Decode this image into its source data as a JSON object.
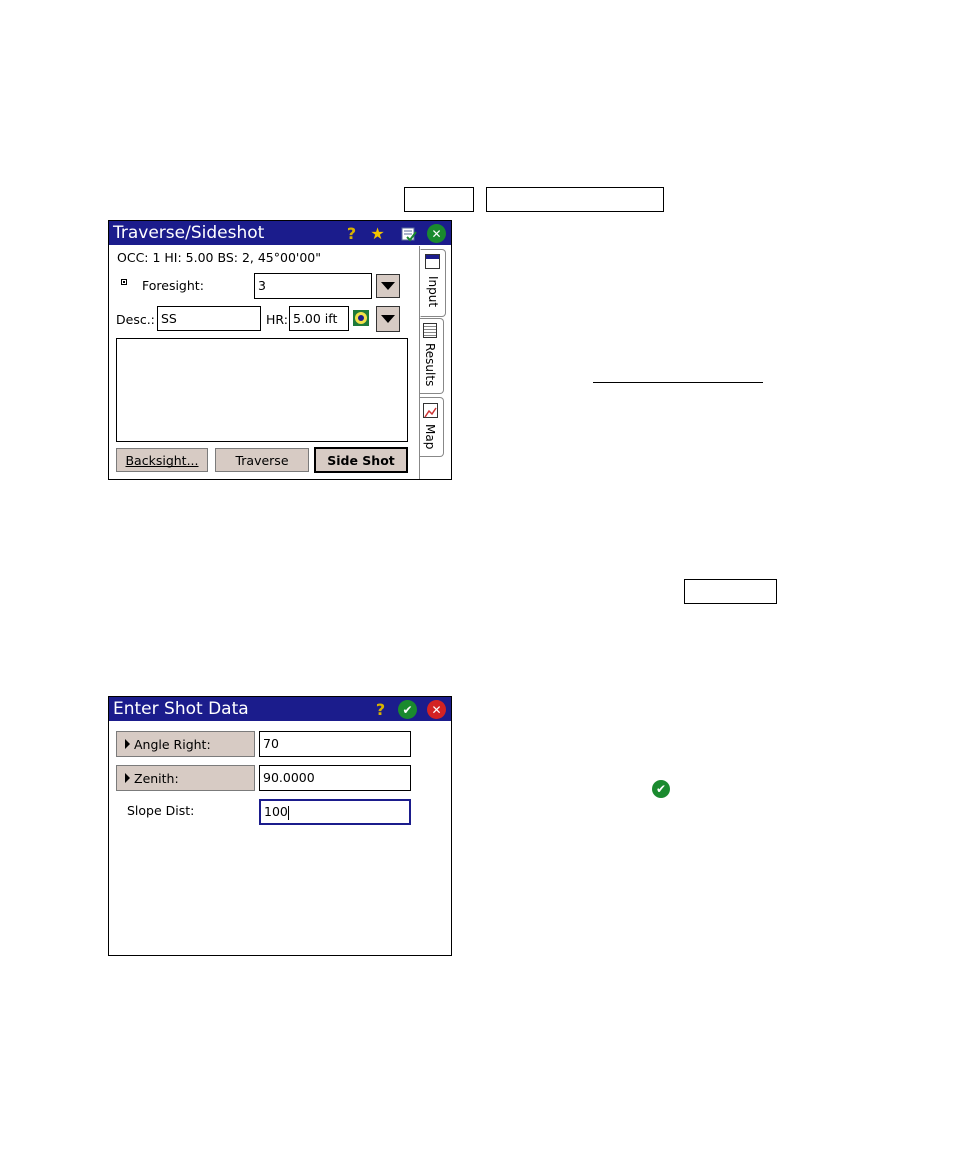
{
  "traverse": {
    "title": "Traverse/Sideshot",
    "status_line": "OCC: 1  HI: 5.00  BS: 2, 45°00'00\"",
    "foresight_label": "Foresight:",
    "foresight_value": "3",
    "desc_label": "Desc.:",
    "desc_value": "SS",
    "hr_label": "HR:",
    "hr_value": "5.00 ift",
    "buttons": {
      "backsight": "Backsight...",
      "traverse": "Traverse",
      "sideshot": "Side Shot"
    },
    "tabs": {
      "input": "Input",
      "results": "Results",
      "map": "Map"
    }
  },
  "shot": {
    "title": "Enter Shot Data",
    "angle_label": "Angle Right:",
    "angle_value": "70",
    "zenith_label": "Zenith:",
    "zenith_value": "90.0000",
    "slope_label": "Slope Dist:",
    "slope_value": "100"
  },
  "icons": {
    "help": "question-mark-icon",
    "favorite": "star-icon",
    "list": "list-check-icon",
    "close": "close-icon",
    "ok": "check-icon",
    "cancel": "cancel-icon",
    "target": "prism-target-icon"
  },
  "colors": {
    "titlebar": "#1b1c8c",
    "button_face": "#d7cbc4",
    "ok_green": "#1a8a2e",
    "cancel_red": "#d32323"
  }
}
